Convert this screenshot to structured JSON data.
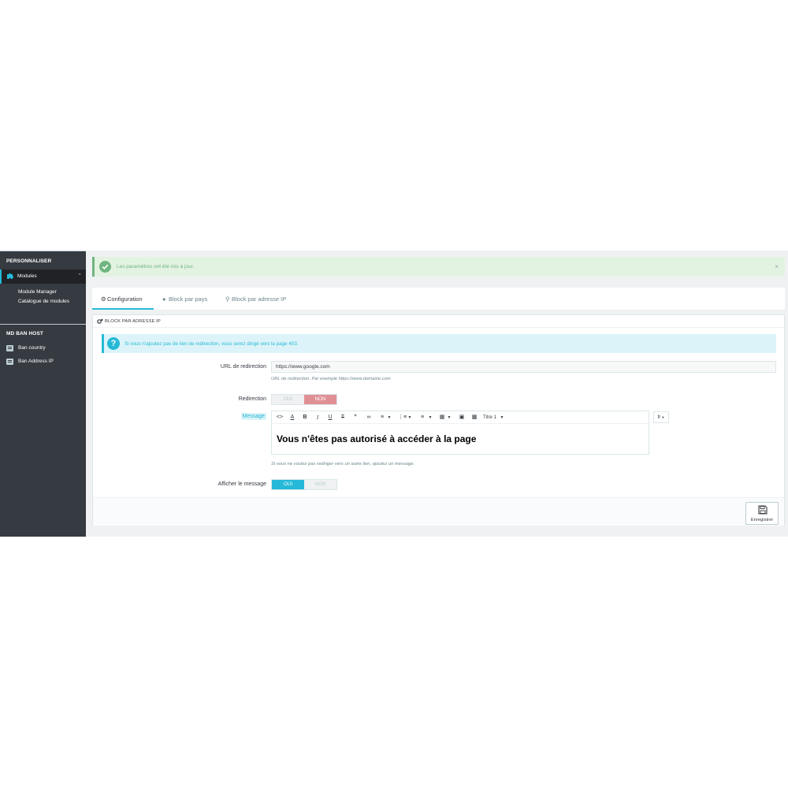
{
  "sidebar": {
    "section_customize": "PERSONNALISER",
    "modules_label": "Modules",
    "sub_items": [
      "Module Manager",
      "Catalogue de modules"
    ],
    "section_ban": "MD BAN HOST",
    "ban_items": [
      "Ban country",
      "Ban Address IP"
    ]
  },
  "alert": {
    "message": "Les paramètres ont été mis à jour.",
    "close": "×"
  },
  "tabs": [
    {
      "label": "Configuration",
      "icon": "gears-icon",
      "active": true
    },
    {
      "label": "Block par pays",
      "icon": "globe-icon",
      "active": false
    },
    {
      "label": "Block par adresse IP",
      "icon": "map-marker-icon",
      "active": false
    }
  ],
  "panel": {
    "title": "BLOCK PAR ADRESSE IP",
    "info": "Si vous n'ajoutez pas de lien de redirection, vous serez dirigé vers la page 403.",
    "url_label": "URL de redirection",
    "url_value": "https://www.google.com",
    "url_help": "URL de redirection. Par exemple https://www.domaine.com",
    "redirection_label": "Redirection",
    "redirection_yes": "OUI",
    "redirection_no": "NON",
    "message_label": "Message",
    "editor_content": "Vous n'êtes pas autorisé à accéder à la page",
    "toolbar_heading": "Titre 1",
    "lang": "fr",
    "message_help": "Si vous ne voulez pas rediriger vers un autre lien, ajoutez un message.",
    "show_label": "Afficher le message",
    "show_yes": "OUI",
    "show_no": "NON",
    "save_label": "Enregistrer"
  },
  "colors": {
    "accent": "#25b9d7",
    "success": "#70b580",
    "danger_soft": "#e08f95",
    "sidebar_bg": "#363a41"
  }
}
